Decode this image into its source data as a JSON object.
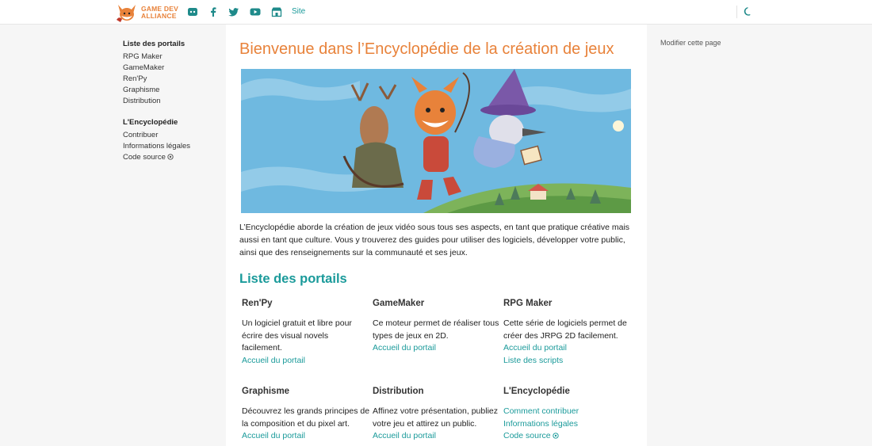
{
  "header": {
    "logo_line1": "GAME DEV",
    "logo_line2": "ALLIANCE",
    "site_link": "Site",
    "social_icons": [
      "discord-icon",
      "facebook-icon",
      "twitter-icon",
      "youtube-icon",
      "store-icon"
    ],
    "colors": {
      "brand_orange": "#e8823a",
      "link_teal": "#1a9a9a",
      "icon_gray": "#1e8a8a"
    }
  },
  "sidebar": {
    "group1": {
      "heading": "Liste des portails",
      "items": [
        "RPG Maker",
        "GameMaker",
        "Ren'Py",
        "Graphisme",
        "Distribution"
      ]
    },
    "group2": {
      "heading": "L'Encyclopédie",
      "items": [
        "Contribuer",
        "Informations légales",
        "Code source"
      ]
    }
  },
  "main": {
    "title": "Bienvenue dans l’Encyclopédie de la création de jeux",
    "intro": "L’Encyclopédie aborde la création de jeux vidéo sous tous ses aspects, en tant que pratique créative mais aussi en tant que culture. Vous y trouverez des guides pour utiliser des logiciels, développer votre public, ainsi que des renseignements sur la communauté et ses jeux.",
    "portals_heading": "Liste des portails",
    "portals": [
      {
        "title": "Ren'Py",
        "desc": "Un logiciel gratuit et libre pour écrire des visual novels facilement.",
        "links": [
          "Accueil du portail"
        ]
      },
      {
        "title": "GameMaker",
        "desc": "Ce moteur permet de réaliser tous types de jeux en 2D.",
        "links": [
          "Accueil du portail"
        ]
      },
      {
        "title": "RPG Maker",
        "desc": "Cette série de logiciels permet de créer des JRPG 2D facilement.",
        "links": [
          "Accueil du portail",
          "Liste des scripts"
        ]
      },
      {
        "title": "Graphisme",
        "desc": "Découvrez les grands principes de la composition et du pixel art.",
        "links": [
          "Accueil du portail"
        ]
      },
      {
        "title": "Distribution",
        "desc": "Affinez votre présentation, publiez votre jeu et attirez un public.",
        "links": [
          "Accueil du portail"
        ]
      },
      {
        "title": "L'Encyclopédie",
        "desc": "",
        "links": [
          "Comment contribuer",
          "Informations légales",
          "Code source"
        ]
      }
    ]
  },
  "right": {
    "edit_link": "Modifier cette page"
  }
}
